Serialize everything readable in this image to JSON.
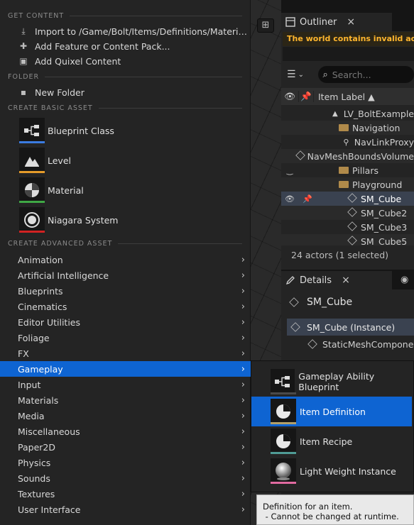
{
  "viewport": {
    "view_button_icon": "grid-view-icon"
  },
  "outliner": {
    "tab_label": "Outliner",
    "close_glyph": "×",
    "warning": "The world contains invalid actor files",
    "search_placeholder": "Search...",
    "column_label": "Item Label ▲",
    "rows": [
      {
        "label": "LV_BoltExample",
        "icon": "level-icon",
        "indent": 0
      },
      {
        "label": "Navigation",
        "icon": "folder-icon",
        "indent": 1
      },
      {
        "label": "NavLinkProxy",
        "icon": "navlink-icon",
        "indent": 2
      },
      {
        "label": "NavMeshBoundsVolume",
        "icon": "navmesh-icon",
        "indent": 2
      },
      {
        "label": "Pillars",
        "icon": "folder-icon",
        "indent": 1
      },
      {
        "label": "Playground",
        "icon": "folder-open-icon",
        "indent": 1
      },
      {
        "label": "SM_Cube",
        "icon": "static-mesh-icon",
        "indent": 2
      },
      {
        "label": "SM_Cube2",
        "icon": "static-mesh-icon",
        "indent": 2
      },
      {
        "label": "SM_Cube3",
        "icon": "static-mesh-icon",
        "indent": 2
      },
      {
        "label": "SM_Cube5",
        "icon": "static-mesh-icon",
        "indent": 2
      }
    ],
    "footer": "24 actors (1 selected)"
  },
  "details": {
    "tab_label": "Details",
    "close_glyph": "×",
    "actor_name": "SM_Cube",
    "component_instance": "SM_Cube (Instance)",
    "sub_component": "StaticMeshComponent"
  },
  "menu": {
    "sections": {
      "get_content": "GET CONTENT",
      "folder": "FOLDER",
      "basic": "CREATE BASIC ASSET",
      "advanced": "CREATE ADVANCED ASSET"
    },
    "get_content_items": [
      {
        "label": "Import to /Game/Bolt/Items/Definitions/Materials...",
        "icon": "import-icon"
      },
      {
        "label": "Add Feature or Content Pack...",
        "icon": "feature-pack-icon"
      },
      {
        "label": "Add Quixel Content",
        "icon": "quixel-icon"
      }
    ],
    "folder_items": [
      {
        "label": "New Folder",
        "icon": "new-folder-icon"
      }
    ],
    "basic_assets": [
      {
        "label": "Blueprint Class",
        "icon": "blueprint-class-icon",
        "color": "#3b7be0"
      },
      {
        "label": "Level",
        "icon": "level-icon",
        "color": "#e59b2a"
      },
      {
        "label": "Material",
        "icon": "material-icon",
        "color": "#3fa845"
      },
      {
        "label": "Niagara System",
        "icon": "niagara-system-icon",
        "color": "#d22222"
      }
    ],
    "advanced_items": [
      "Animation",
      "Artificial Intelligence",
      "Blueprints",
      "Cinematics",
      "Editor Utilities",
      "Foliage",
      "FX",
      "Gameplay",
      "Input",
      "Materials",
      "Media",
      "Miscellaneous",
      "Paper2D",
      "Physics",
      "Sounds",
      "Textures",
      "User Interface"
    ],
    "active_advanced": "Gameplay"
  },
  "submenu": {
    "items": [
      {
        "label": "Gameplay Ability Blueprint",
        "icon": "blueprint-graph-icon",
        "color": "#4a4a4a"
      },
      {
        "label": "Item Definition",
        "icon": "pie-icon",
        "color": "#b3a06a"
      },
      {
        "label": "Item Recipe",
        "icon": "pie-icon",
        "color": "#4f9b95"
      },
      {
        "label": "Light Weight Instance",
        "icon": "sphere-icon",
        "color": "#e06aa0"
      }
    ],
    "selected": "Item Definition"
  },
  "tooltip": {
    "line1": "Definition for an item.",
    "line2": " - Cannot be changed at runtime."
  },
  "colors": {
    "accent": "#0e64d2",
    "selection_row": "#3a4250",
    "warning_text": "#ffb62e"
  }
}
